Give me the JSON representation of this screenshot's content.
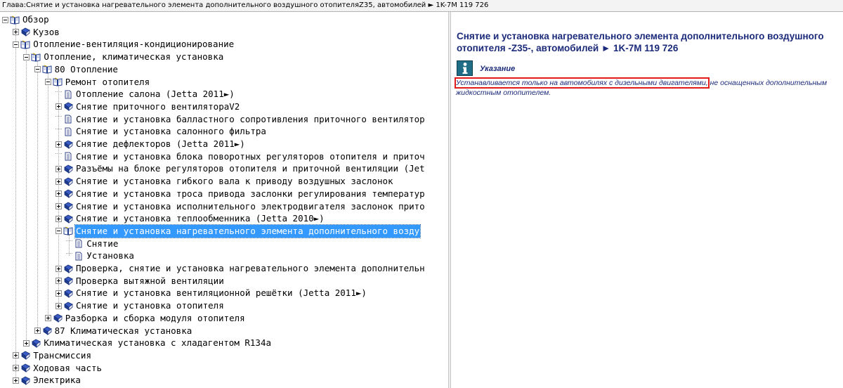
{
  "window": {
    "title": "Глава:Снятие и установка нагревательного элемента дополнительного воздушного отопителяZ35, автомобилей ► 1K-7M 119 726"
  },
  "tree": {
    "items": [
      {
        "label": "Обзор"
      },
      {
        "label": "Кузов"
      },
      {
        "label": "Отопление-вентиляция-кондиционирование"
      },
      {
        "label": "Отопление, климатическая установка"
      },
      {
        "label": "80 Отопление"
      },
      {
        "label": "Ремонт отопителя"
      },
      {
        "label": "Отопление салона (Jetta 2011►)"
      },
      {
        "label": "Снятие приточного вентилятораV2"
      },
      {
        "label": "Снятие и установка балластного сопротивления приточного вентилятор"
      },
      {
        "label": "Снятие и установка салонного фильтра"
      },
      {
        "label": "Снятие дефлекторов (Jetta 2011►)"
      },
      {
        "label": "Снятие и установка блока поворотных регуляторов отопителя и приточ"
      },
      {
        "label": "Разъёмы на блоке регуляторов отопителя и приточной вентиляции (Jet"
      },
      {
        "label": "Снятие и установка гибкого вала к приводу воздушных заслонок"
      },
      {
        "label": "Снятие и установка троса привода заслонки регулирования температур"
      },
      {
        "label": "Снятие и установка исполнительного электродвигателя заслонок прито"
      },
      {
        "label": "Снятие и установка теплообменника (Jetta 2010►)"
      },
      {
        "label": "Снятие и установка нагревательного элемента дополнительного возду"
      },
      {
        "label": "Снятие"
      },
      {
        "label": "Установка"
      },
      {
        "label": "Проверка, снятие и установка нагревательного элемента дополнительн"
      },
      {
        "label": "Проверка вытяжной вентиляции"
      },
      {
        "label": "Снятие и установка вентиляционной решётки (Jetta 2011►)"
      },
      {
        "label": "Снятие и установка отопителя"
      },
      {
        "label": "Разборка и сборка модуля отопителя"
      },
      {
        "label": "87 Климатическая установка"
      },
      {
        "label": "Климатическая установка с хладагентом R134a"
      },
      {
        "label": "Трансмиссия"
      },
      {
        "label": "Ходовая часть"
      },
      {
        "label": "Электрика"
      }
    ]
  },
  "content": {
    "title": "Снятие и установка нагревательного элемента дополнительного воздушного отопителя -Z35-, автомобилей ► 1K-7M 119 726",
    "note_icon": "info-icon",
    "note_label": "Указание",
    "note_text_highlighted": "Устанавливается только на автомобилях с дизельными двигателями,",
    "note_text_rest": " не оснащенных дополнительным жидкостным отопителем."
  },
  "colors": {
    "selection": "#3399ff",
    "content_text": "#1b2a7a",
    "highlight_box": "#e31b1b",
    "book_blue": "#1f3c8f"
  }
}
